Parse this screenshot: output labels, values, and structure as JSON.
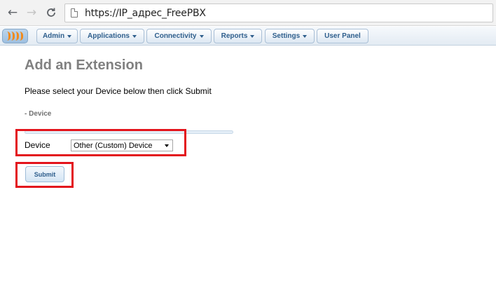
{
  "browser": {
    "url": "https://IP_адрес_FreePBX",
    "icons": {
      "back": "arrow-left-icon",
      "forward": "arrow-right-icon",
      "reload": "reload-icon",
      "page": "page-icon"
    }
  },
  "menu": {
    "items": [
      {
        "label": "Admin",
        "has_dropdown": true
      },
      {
        "label": "Applications",
        "has_dropdown": true
      },
      {
        "label": "Connectivity",
        "has_dropdown": true
      },
      {
        "label": "Reports",
        "has_dropdown": true
      },
      {
        "label": "Settings",
        "has_dropdown": true
      },
      {
        "label": "User Panel",
        "has_dropdown": false
      }
    ]
  },
  "content": {
    "title": "Add an Extension",
    "instruction": "Please select your Device below then click Submit",
    "section_label": "- Device",
    "device_label": "Device",
    "device_selected": "Other (Custom) Device",
    "submit_label": "Submit"
  },
  "colors": {
    "menu_text": "#2e5e8c",
    "title": "#808080",
    "highlight": "#e3141c",
    "logo_accent": "#f08a1c"
  }
}
